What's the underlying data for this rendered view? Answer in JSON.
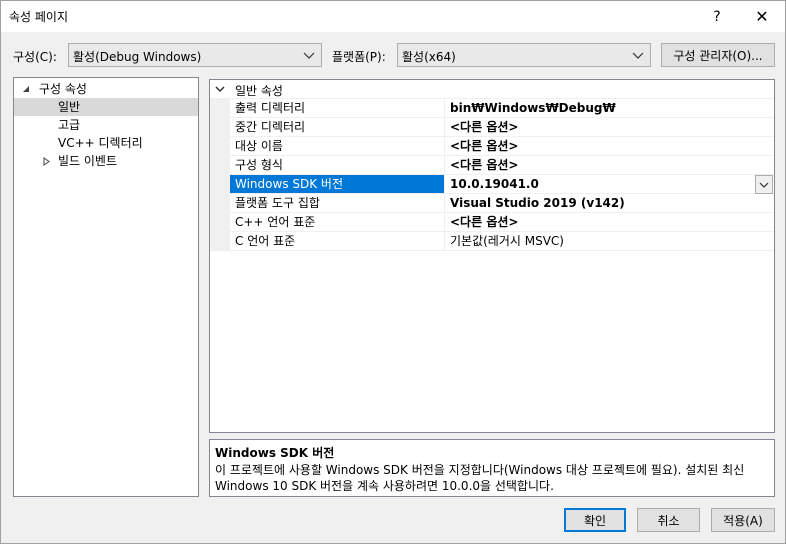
{
  "window": {
    "title": "속성 페이지",
    "help_label": "?",
    "close_label": "✕"
  },
  "toolbar": {
    "config_label": "구성(C):",
    "config_value": "활성(Debug Windows)",
    "platform_label": "플랫폼(P):",
    "platform_value": "활성(x64)",
    "config_manager_label": "구성 관리자(O)..."
  },
  "tree": {
    "root_label": "구성 속성",
    "items": [
      {
        "label": "일반"
      },
      {
        "label": "고급"
      },
      {
        "label": "VC++ 디렉터리"
      },
      {
        "label": "빌드 이벤트"
      }
    ]
  },
  "grid": {
    "category_label": "일반 속성",
    "rows": [
      {
        "name": "출력 디렉터리",
        "value": "bin₩Windows₩Debug₩"
      },
      {
        "name": "중간 디렉터리",
        "value": "<다른 옵션>"
      },
      {
        "name": "대상 이름",
        "value": "<다른 옵션>"
      },
      {
        "name": "구성 형식",
        "value": "<다른 옵션>"
      },
      {
        "name": "Windows SDK 버전",
        "value": "10.0.19041.0"
      },
      {
        "name": "플랫폼 도구 집합",
        "value": "Visual Studio 2019 (v142)"
      },
      {
        "name": "C++ 언어 표준",
        "value": "<다른 옵션>"
      },
      {
        "name": "C 언어 표준",
        "value": "기본값(레거시 MSVC)"
      }
    ]
  },
  "description": {
    "title": "Windows SDK 버전",
    "text": "이 프로젝트에 사용할 Windows SDK 버전을 지정합니다(Windows 대상 프로젝트에 필요). 설치된 최신 Windows 10 SDK 버전을 계속 사용하려면 10.0.0을 선택합니다."
  },
  "buttons": {
    "ok": "확인",
    "cancel": "취소",
    "apply": "적용(A)"
  },
  "colors": {
    "accent": "#0078d7",
    "selected_tree": "#d9d9d9",
    "window_bg": "#f0f0f0"
  }
}
